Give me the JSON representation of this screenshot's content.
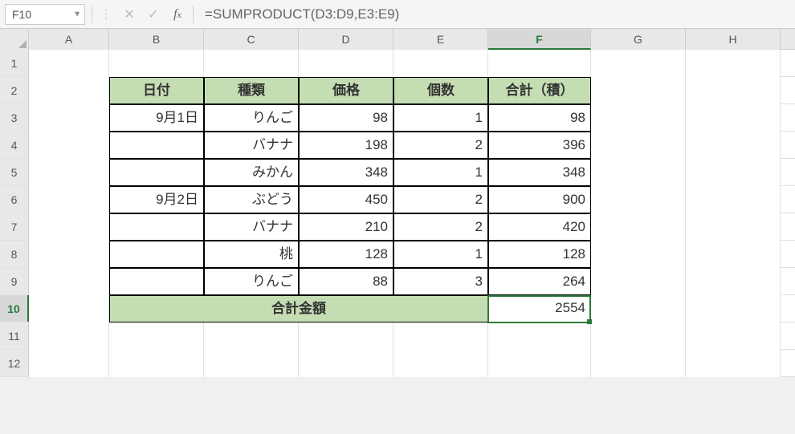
{
  "name_box": "F10",
  "formula": "=SUMPRODUCT(D3:D9,E3:E9)",
  "columns": [
    "A",
    "B",
    "C",
    "D",
    "E",
    "F",
    "G",
    "H"
  ],
  "row_numbers": [
    "1",
    "2",
    "3",
    "4",
    "5",
    "6",
    "7",
    "8",
    "9",
    "10",
    "11",
    "12"
  ],
  "headers": {
    "date": "日付",
    "type": "種類",
    "price": "価格",
    "qty": "個数",
    "subtotal": "合計（積）"
  },
  "rows": [
    {
      "date": "9月1日",
      "type": "りんご",
      "price": "98",
      "qty": "1",
      "subtotal": "98"
    },
    {
      "date": "",
      "type": "バナナ",
      "price": "198",
      "qty": "2",
      "subtotal": "396"
    },
    {
      "date": "",
      "type": "みかん",
      "price": "348",
      "qty": "1",
      "subtotal": "348"
    },
    {
      "date": "9月2日",
      "type": "ぶどう",
      "price": "450",
      "qty": "2",
      "subtotal": "900"
    },
    {
      "date": "",
      "type": "バナナ",
      "price": "210",
      "qty": "2",
      "subtotal": "420"
    },
    {
      "date": "",
      "type": "桃",
      "price": "128",
      "qty": "1",
      "subtotal": "128"
    },
    {
      "date": "",
      "type": "りんご",
      "price": "88",
      "qty": "3",
      "subtotal": "264"
    }
  ],
  "total_label": "合計金額",
  "total_value": "2554",
  "active_cell": "F10",
  "selected_col": "F",
  "selected_row": "10"
}
